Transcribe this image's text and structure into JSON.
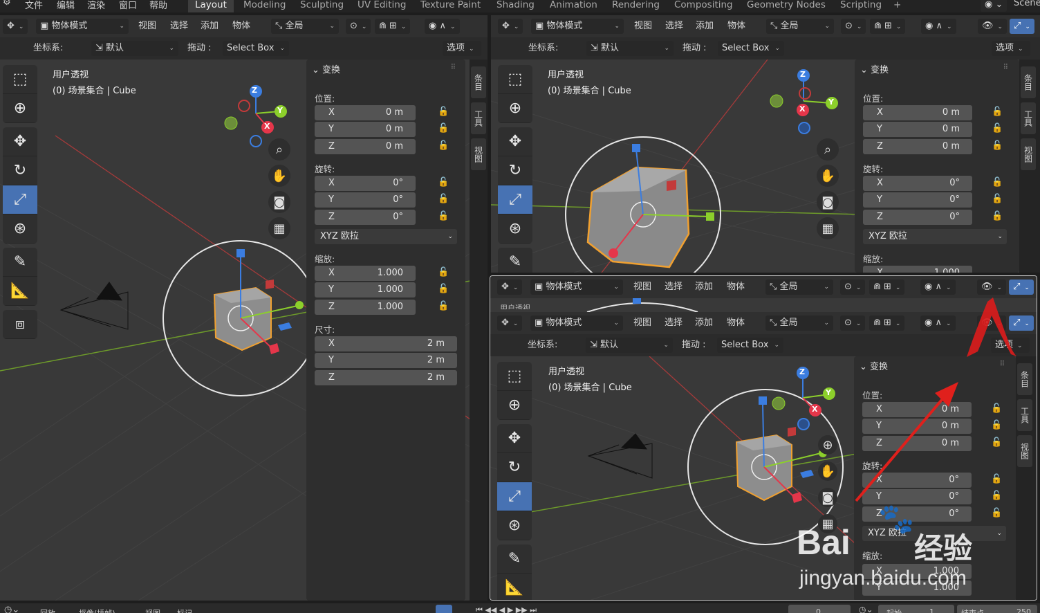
{
  "topbar": {
    "menus": [
      "文件",
      "编辑",
      "渲染",
      "窗口",
      "帮助"
    ],
    "tabs": [
      "Layout",
      "Modeling",
      "Sculpting",
      "UV Editing",
      "Texture Paint",
      "Shading",
      "Animation",
      "Rendering",
      "Compositing",
      "Geometry Nodes",
      "Scripting"
    ],
    "scene": "Scene"
  },
  "header": {
    "mode": "物体模式",
    "menu": [
      "视图",
      "选择",
      "添加",
      "物体"
    ],
    "transform_space": "全局"
  },
  "options": {
    "coord_label": "坐标系:",
    "coord_value": "默认",
    "drag_label": "拖动 :",
    "drag_value": "Select Box",
    "options_btn": "选项"
  },
  "viewport": {
    "view_name": "用户透视",
    "collection": "(0) 场景集合 | Cube",
    "partial_label": "用户透视"
  },
  "panel": {
    "title": "变换",
    "location": "位置:",
    "rotation": "旋转:",
    "mode": "XYZ 欧拉",
    "scale": "缩放:",
    "dimensions": "尺寸:",
    "axes": [
      "X",
      "Y",
      "Z"
    ],
    "loc": [
      "0 m",
      "0 m",
      "0 m"
    ],
    "rot": [
      "0°",
      "0°",
      "0°"
    ],
    "scl": [
      "1.000",
      "1.000",
      "1.000"
    ],
    "dim": [
      "2 m",
      "2 m",
      "2 m"
    ]
  },
  "sidetabs": [
    "条目",
    "工具",
    "视图"
  ],
  "gizmo": {
    "z": "Z",
    "y": "Y",
    "x": "X"
  },
  "timeline": {
    "items": [
      "回放",
      "抠像(插帧)",
      "视图",
      "标记"
    ],
    "frame": "0",
    "start_label": "起始",
    "start": "1",
    "end_label": "结束点",
    "end": "250"
  },
  "watermark": {
    "brand": "Bai",
    "brand2": "经验",
    "url": "jingyan.baidu.com"
  },
  "colors": {
    "accent": "#4772b3",
    "x_axis": "#e5364a",
    "y_axis": "#8ccf2b",
    "z_axis": "#3b7de0",
    "selection": "#f0a030",
    "arrow": "#e0201c"
  }
}
